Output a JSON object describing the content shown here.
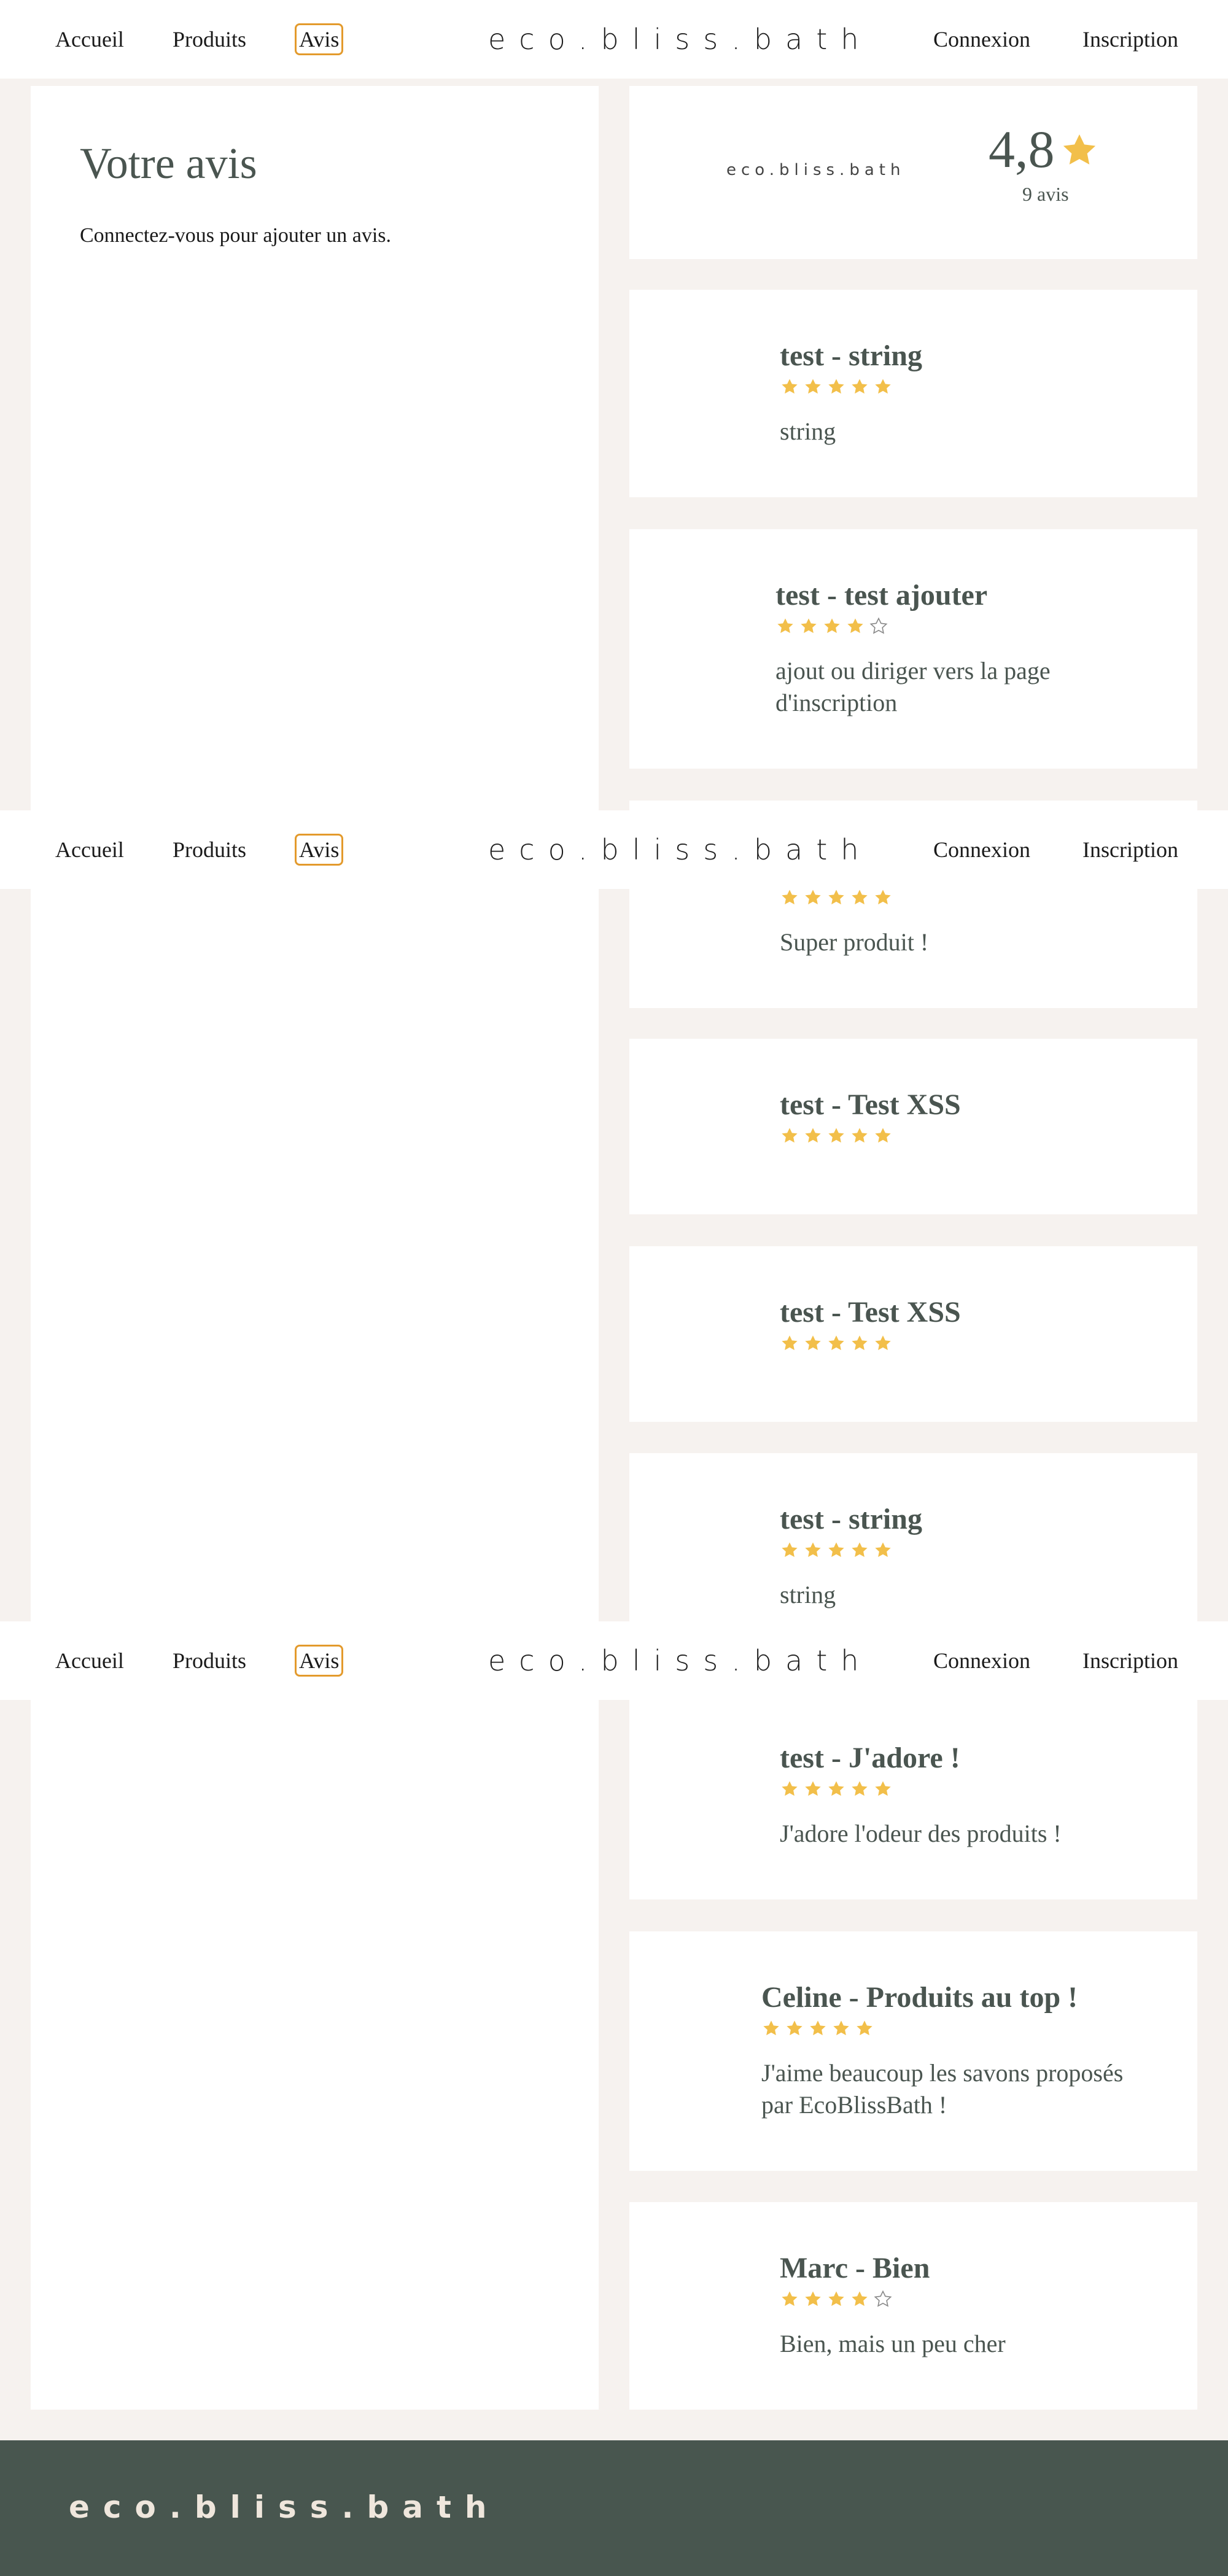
{
  "nav": {
    "links": [
      "Accueil",
      "Produits",
      "Avis"
    ],
    "active": "Avis",
    "brand": "eco.bliss.bath",
    "login": "Connexion",
    "signup": "Inscription"
  },
  "left": {
    "title": "Votre avis",
    "message": "Connectez-vous pour ajouter un avis."
  },
  "summary": {
    "brand": "eco.bliss.bath",
    "score": "4,8",
    "count": "9 avis"
  },
  "colors": {
    "star": "#f2bf4a",
    "active_border": "#e39a2c",
    "footer_bg": "#48564f",
    "heading": "#4a5550"
  },
  "reviews": [
    {
      "title": "test - string",
      "rating": 5,
      "comment": "string"
    },
    {
      "title": "test - test ajouter",
      "rating": 4,
      "comment": "ajout ou diriger vers la page d'inscription"
    },
    {
      "title": "",
      "rating": 5,
      "comment": "Super produit !"
    },
    {
      "title": "test - Test XSS",
      "rating": 5,
      "comment": ""
    },
    {
      "title": "test - Test XSS",
      "rating": 5,
      "comment": ""
    },
    {
      "title": "test - string",
      "rating": 5,
      "comment": "string"
    },
    {
      "title": "test - J'adore !",
      "rating": 5,
      "comment": "J'adore l'odeur des produits !"
    },
    {
      "title": "Celine - Produits au top !",
      "rating": 5,
      "comment": "J'aime beaucoup les savons proposés par EcoBlissBath !"
    },
    {
      "title": "Marc - Bien",
      "rating": 4,
      "comment": "Bien, mais un peu cher"
    }
  ],
  "footer": {
    "brand": "eco.bliss.bath"
  }
}
